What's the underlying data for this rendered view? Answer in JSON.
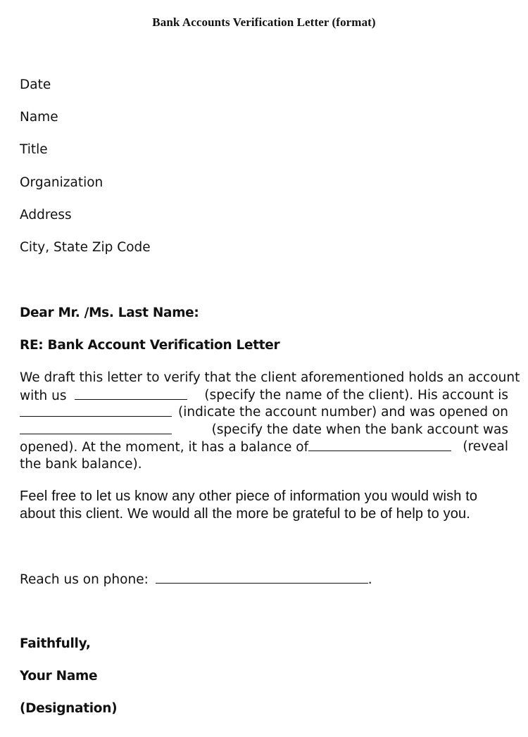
{
  "document": {
    "title": "Bank Accounts Verification Letter (format)",
    "header_fields": [
      "Date",
      "Name",
      "Title",
      "Organization",
      "Address",
      "City, State Zip Code"
    ],
    "salutation": "Dear Mr. /Ms. Last Name:",
    "subject": "RE: Bank Account Verification Letter",
    "body_paragraph": {
      "l1_a": "We draft this letter to verify that the client aforementioned holds an account",
      "l2_a": "with us",
      "l2_b": "(specify the name of the client). His account is",
      "l3_b": "(indicate the account number) and was opened on",
      "l4_b": "(specify the date when the bank account was",
      "l5_a": "opened). At the moment, it has a balance of",
      "l5_b": "(reveal",
      "l6_a": "the bank balance)."
    },
    "closing_paragraph": {
      "l1": "Feel free to let us know any other piece of information you would wish to",
      "l2": "about this client. We would all the more be grateful to be of help to you."
    },
    "phone_label": "Reach us on phone:",
    "phone_end": ".",
    "signoff": "Faithfully,",
    "signature_name": "Your Name",
    "signature_designation": "(Designation)"
  }
}
